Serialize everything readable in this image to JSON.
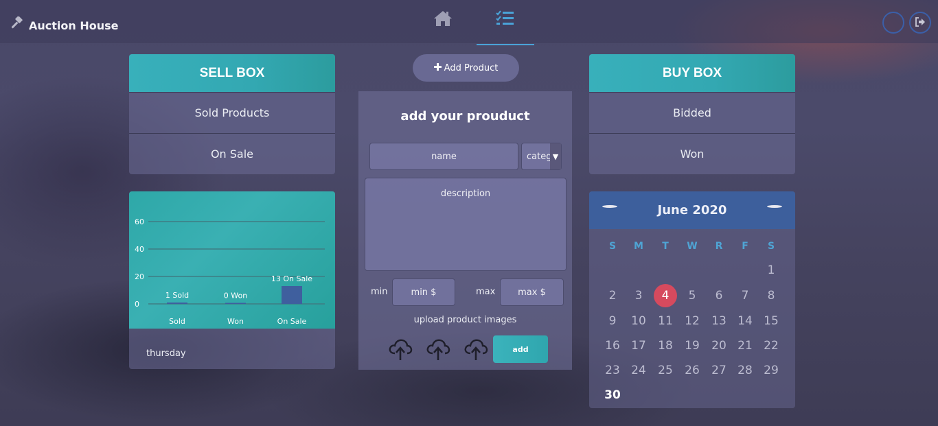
{
  "header": {
    "title": "Auction House",
    "brand_icon": "gavel-icon",
    "nav_tabs": [
      {
        "icon": "home-icon",
        "active": false
      },
      {
        "icon": "tasks-list-icon",
        "active": true
      }
    ],
    "right_buttons": [
      {
        "icon": "circle-icon"
      },
      {
        "icon": "sign-out-icon"
      }
    ]
  },
  "sell_box": {
    "title": "SELL BOX",
    "items": [
      "Sold Products",
      "On Sale"
    ]
  },
  "buy_box": {
    "title": "BUY BOX",
    "items": [
      "Bidded",
      "Won"
    ]
  },
  "stats": {
    "day": "thursday"
  },
  "chart_data": {
    "type": "bar",
    "categories": [
      "Sold",
      "Won",
      "On Sale"
    ],
    "values": [
      1,
      0,
      13
    ],
    "data_labels": [
      "1 Sold",
      "0 Won",
      "13 On Sale"
    ],
    "yticks": [
      0,
      20,
      40,
      60
    ],
    "ylim": [
      0,
      70
    ],
    "grid": true,
    "title": "",
    "xlabel": "",
    "ylabel": "",
    "colors": {
      "bar": "#3f5f9e",
      "grid": "#3f7d83",
      "text": "#ffffff"
    }
  },
  "add_product": {
    "button_label": "Add Product",
    "form_title": "add your prouduct",
    "name_placeholder": "name",
    "category_value": "categ",
    "description_placeholder": "description",
    "min_label": "min",
    "min_placeholder": "min $",
    "max_label": "max",
    "max_placeholder": "max $",
    "upload_label": "upload product images",
    "upload_icon": "cloud-upload-icon",
    "add_label": "add"
  },
  "calendar": {
    "month_label": "June 2020",
    "weekdays": [
      "S",
      "M",
      "T",
      "W",
      "R",
      "F",
      "S"
    ],
    "days": [
      "1",
      "2",
      "3",
      "4",
      "5",
      "6",
      "7",
      "8",
      "9",
      "10",
      "11",
      "12",
      "13",
      "14",
      "15",
      "16",
      "17",
      "18",
      "19",
      "20",
      "21",
      "22",
      "23",
      "24",
      "25",
      "26",
      "27",
      "28",
      "29",
      "30"
    ],
    "first_weekday_index": 6,
    "today": "4",
    "colors": {
      "header": "#3d5f9c",
      "today": "#d64a5e",
      "weekday": "#4fa4d4"
    }
  }
}
